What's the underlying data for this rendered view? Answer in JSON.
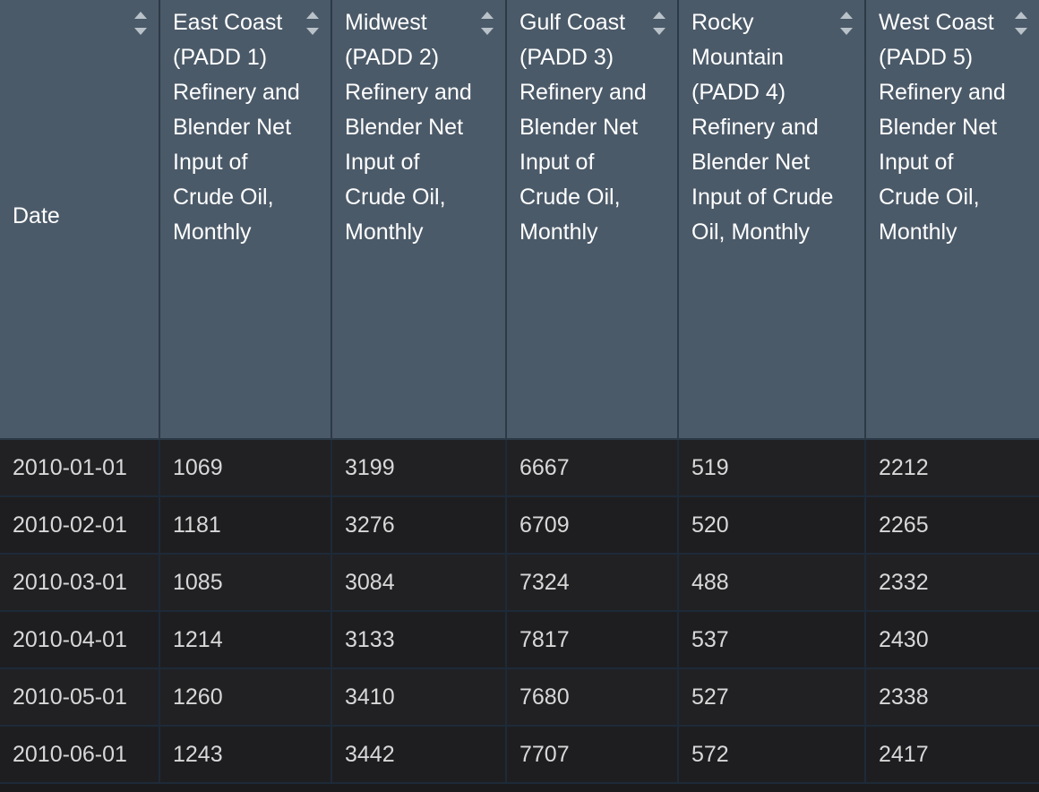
{
  "table": {
    "sort_icon_name": "sort-ascending-descending-icon",
    "columns": [
      {
        "key": "date",
        "label": "Date",
        "sortable": true,
        "align_top": false
      },
      {
        "key": "padd1",
        "label": "East Coast (PADD 1) Refinery and Blender Net Input of Crude Oil, Monthly",
        "sortable": true,
        "align_top": true
      },
      {
        "key": "padd2",
        "label": "Midwest (PADD 2) Refinery and Blender Net Input of Crude Oil, Monthly",
        "sortable": true,
        "align_top": true
      },
      {
        "key": "padd3",
        "label": "Gulf Coast (PADD 3) Refinery and Blender Net Input of Crude Oil, Monthly",
        "sortable": true,
        "align_top": true
      },
      {
        "key": "padd4",
        "label": "Rocky Mountain (PADD 4) Refinery and Blender Net Input of Crude Oil, Monthly",
        "sortable": true,
        "align_top": true
      },
      {
        "key": "padd5",
        "label": "West Coast (PADD 5) Refinery and Blender Net Input of Crude Oil, Monthly",
        "sortable": true,
        "align_top": true
      }
    ],
    "rows": [
      {
        "date": "2010-01-01",
        "padd1": "1069",
        "padd2": "3199",
        "padd3": "6667",
        "padd4": "519",
        "padd5": "2212"
      },
      {
        "date": "2010-02-01",
        "padd1": "1181",
        "padd2": "3276",
        "padd3": "6709",
        "padd4": "520",
        "padd5": "2265"
      },
      {
        "date": "2010-03-01",
        "padd1": "1085",
        "padd2": "3084",
        "padd3": "7324",
        "padd4": "488",
        "padd5": "2332"
      },
      {
        "date": "2010-04-01",
        "padd1": "1214",
        "padd2": "3133",
        "padd3": "7817",
        "padd4": "537",
        "padd5": "2430"
      },
      {
        "date": "2010-05-01",
        "padd1": "1260",
        "padd2": "3410",
        "padd3": "7680",
        "padd4": "527",
        "padd5": "2338"
      },
      {
        "date": "2010-06-01",
        "padd1": "1243",
        "padd2": "3442",
        "padd3": "7707",
        "padd4": "572",
        "padd5": "2417"
      }
    ]
  },
  "colors": {
    "header_background": "#4b5a69",
    "header_text": "#ffffff",
    "body_background": "#212124",
    "body_background_alt": "#1e1e21",
    "body_text": "#d8d8d8",
    "grid_line": "#1d2a38",
    "sort_icon": "#b9c2c9"
  }
}
